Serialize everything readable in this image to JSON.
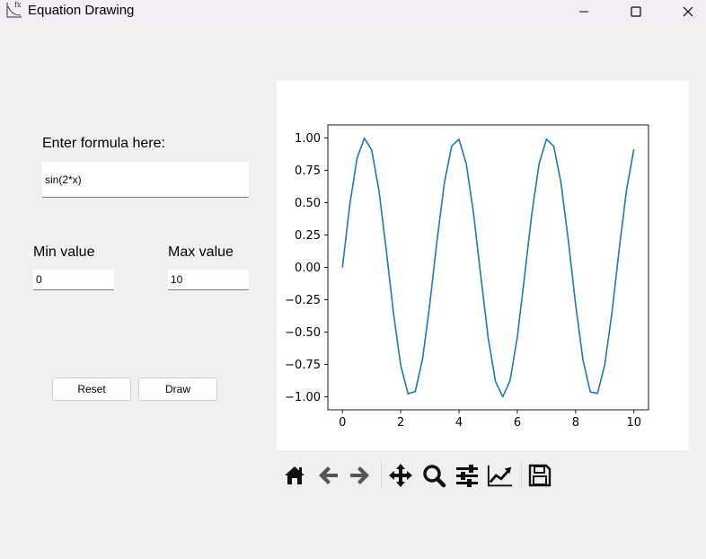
{
  "window": {
    "title": "Equation Drawing",
    "icon": "fx-plot-icon"
  },
  "form": {
    "formula_label": "Enter formula here:",
    "formula_value": "sin(2*x)",
    "min_label": "Min value",
    "min_value": "0",
    "max_label": "Max value",
    "max_value": "10",
    "reset_label": "Reset",
    "draw_label": "Draw"
  },
  "toolbar": {
    "icons": [
      "home-icon",
      "back-arrow-icon",
      "forward-arrow-icon",
      "pan-icon",
      "zoom-icon",
      "configure-subplots-icon",
      "edit-axis-icon",
      "save-icon"
    ]
  },
  "colors": {
    "line": "#1f77b4",
    "window_bg": "#f0f0f0",
    "titlebar_bg": "#f3eef6"
  },
  "chart_data": {
    "type": "line",
    "title": "",
    "xlabel": "",
    "ylabel": "",
    "xlim": [
      -0.5,
      10.5
    ],
    "ylim": [
      -1.1,
      1.1
    ],
    "xticks": [
      0,
      2,
      4,
      6,
      8,
      10
    ],
    "yticks": [
      1.0,
      0.75,
      0.5,
      0.25,
      0.0,
      -0.25,
      -0.5,
      -0.75,
      -1.0
    ],
    "xtick_labels": [
      "0",
      "2",
      "4",
      "6",
      "8",
      "10"
    ],
    "ytick_labels": [
      "1.00",
      "0.75",
      "0.50",
      "0.25",
      "0.00",
      "−0.25",
      "−0.50",
      "−0.75",
      "−1.00"
    ],
    "grid": false,
    "legend": "none",
    "series": [
      {
        "x": [
          0,
          0.25,
          0.5,
          0.75,
          1,
          1.25,
          1.5,
          1.75,
          2,
          2.25,
          2.5,
          2.75,
          3,
          3.25,
          3.5,
          3.75,
          4,
          4.25,
          4.5,
          4.75,
          5,
          5.25,
          5.5,
          5.75,
          6,
          6.25,
          6.5,
          6.75,
          7,
          7.25,
          7.5,
          7.75,
          8,
          8.25,
          8.5,
          8.75,
          9,
          9.25,
          9.5,
          9.75,
          10
        ],
        "y": [
          0,
          0.479,
          0.841,
          0.997,
          0.909,
          0.598,
          0.141,
          -0.351,
          -0.757,
          -0.976,
          -0.959,
          -0.706,
          -0.279,
          0.215,
          0.657,
          0.938,
          0.989,
          0.798,
          0.412,
          -0.073,
          -0.544,
          -0.881,
          -1.0,
          -0.875,
          -0.537,
          -0.066,
          0.42,
          0.803,
          0.991,
          0.935,
          0.65,
          0.206,
          -0.288,
          -0.713,
          -0.961,
          -0.974,
          -0.751,
          -0.342,
          0.15,
          0.606,
          0.913
        ]
      }
    ]
  }
}
